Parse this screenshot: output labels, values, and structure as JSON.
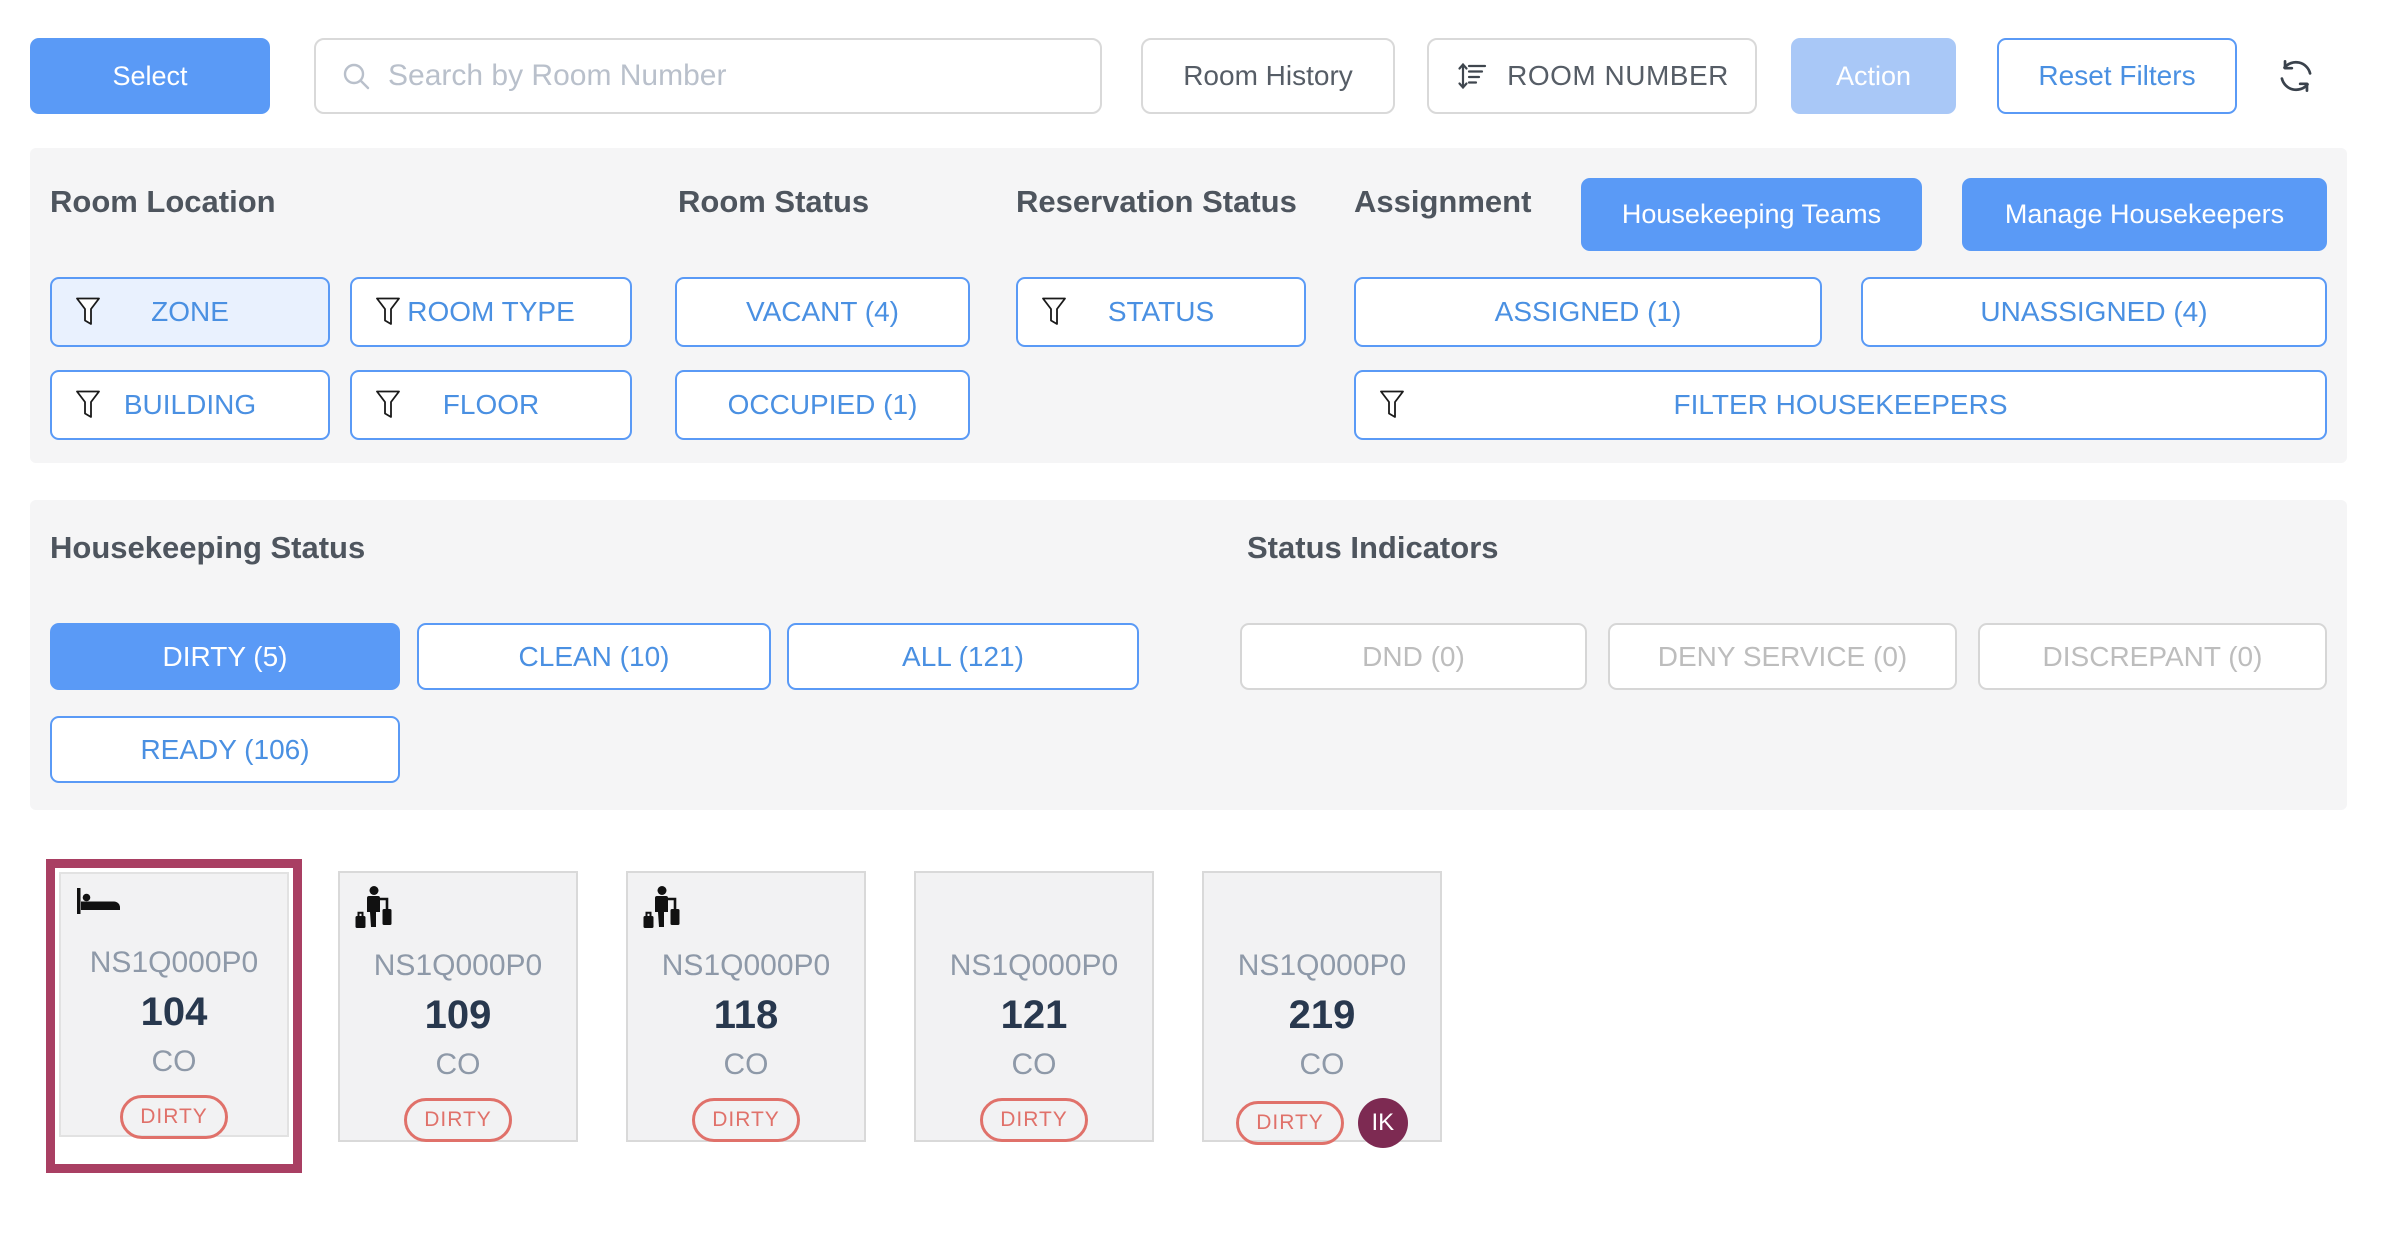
{
  "colors": {
    "primary_blue": "#5a9af6",
    "primary_blue_disabled": "#a9c8f7",
    "blue_text": "#4a90e2",
    "panel_bg": "#f5f5f6",
    "dirty_red": "#e0716a",
    "selected_border": "#a93f63",
    "housekeeper_badge": "#7d2a52"
  },
  "toolbar": {
    "select": "Select",
    "search_placeholder": "Search by Room Number",
    "room_history": "Room History",
    "sort": "ROOM NUMBER",
    "action": "Action",
    "reset_filters": "Reset Filters"
  },
  "filter_panel": {
    "room_location": {
      "title": "Room Location",
      "zone": "ZONE",
      "room_type": "ROOM TYPE",
      "building": "BUILDING",
      "floor": "FLOOR"
    },
    "room_status": {
      "title": "Room Status",
      "vacant": "VACANT (4)",
      "occupied": "OCCUPIED (1)"
    },
    "reservation_status": {
      "title": "Reservation Status",
      "status": "STATUS"
    },
    "assignment": {
      "title": "Assignment",
      "assigned": "ASSIGNED (1)",
      "unassigned": "UNASSIGNED (4)",
      "filter_housekeepers": "FILTER HOUSEKEEPERS"
    },
    "housekeeping_teams": "Housekeeping Teams",
    "manage_housekeepers": "Manage Housekeepers"
  },
  "status_panel": {
    "housekeeping_status": {
      "title": "Housekeeping Status",
      "dirty": "DIRTY (5)",
      "clean": "CLEAN (10)",
      "all": "ALL (121)",
      "ready": "READY (106)"
    },
    "status_indicators": {
      "title": "Status Indicators",
      "dnd": "DND (0)",
      "deny_service": "DENY SERVICE (0)",
      "discrepant": "DISCREPANT (0)"
    }
  },
  "rooms": [
    {
      "code": "NS1Q000P0",
      "number": "104",
      "reservation": "CO",
      "status": "DIRTY",
      "icon": "bed",
      "selected": true
    },
    {
      "code": "NS1Q000P0",
      "number": "109",
      "reservation": "CO",
      "status": "DIRTY",
      "icon": "guest-departing"
    },
    {
      "code": "NS1Q000P0",
      "number": "118",
      "reservation": "CO",
      "status": "DIRTY",
      "icon": "guest-departing"
    },
    {
      "code": "NS1Q000P0",
      "number": "121",
      "reservation": "CO",
      "status": "DIRTY",
      "icon": null
    },
    {
      "code": "NS1Q000P0",
      "number": "219",
      "reservation": "CO",
      "status": "DIRTY",
      "icon": null,
      "housekeeper_initials": "IK"
    }
  ]
}
